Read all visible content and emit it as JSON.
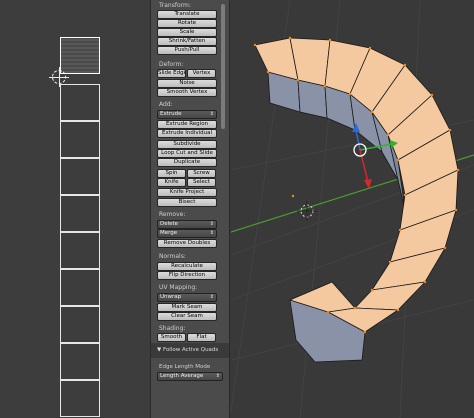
{
  "toolshelf": {
    "transform_header": "Transform:",
    "transform_buttons": [
      "Translate",
      "Rotate",
      "Scale",
      "Shrink/Fatten",
      "Push/Pull"
    ],
    "deform_header": "Deform:",
    "slide_edge": "Slide Edge",
    "vertex": "Vertex",
    "noise": "Noise",
    "smooth_vertex": "Smooth Vertex",
    "add_header": "Add:",
    "extrude_dropdown": "Extrude",
    "extrude_region": "Extrude Region",
    "extrude_individual": "Extrude Individual",
    "subdivide": "Subdivide",
    "loop_cut": "Loop Cut and Slide",
    "duplicate": "Duplicate",
    "spin": "Spin",
    "screw": "Screw",
    "knife": "Knife",
    "select": "Select",
    "knife_project": "Knife Project",
    "bisect": "Bisect",
    "remove_header": "Remove:",
    "delete_dropdown": "Delete",
    "merge_dropdown": "Merge",
    "remove_doubles": "Remove Doubles",
    "normals_header": "Normals:",
    "recalculate": "Recalculate",
    "flip_direction": "Flip Direction",
    "uv_header": "UV Mapping:",
    "unwrap_dropdown": "Unwrap",
    "mark_seam": "Mark Seam",
    "clear_seam": "Clear Seam",
    "shading_header": "Shading:",
    "smooth": "Smooth",
    "flat": "Flat",
    "follow_active": "▼ Follow Active Quads",
    "edge_length_label": "Edge Length Mode",
    "edge_length_value": "Length Average"
  },
  "colors": {
    "face_selected": "#f5c9a0",
    "face_unselected": "#8a92a8",
    "edge": "#1a1a1a",
    "vertex": "#ff8800",
    "grid_axis": "#4d9a2f"
  }
}
